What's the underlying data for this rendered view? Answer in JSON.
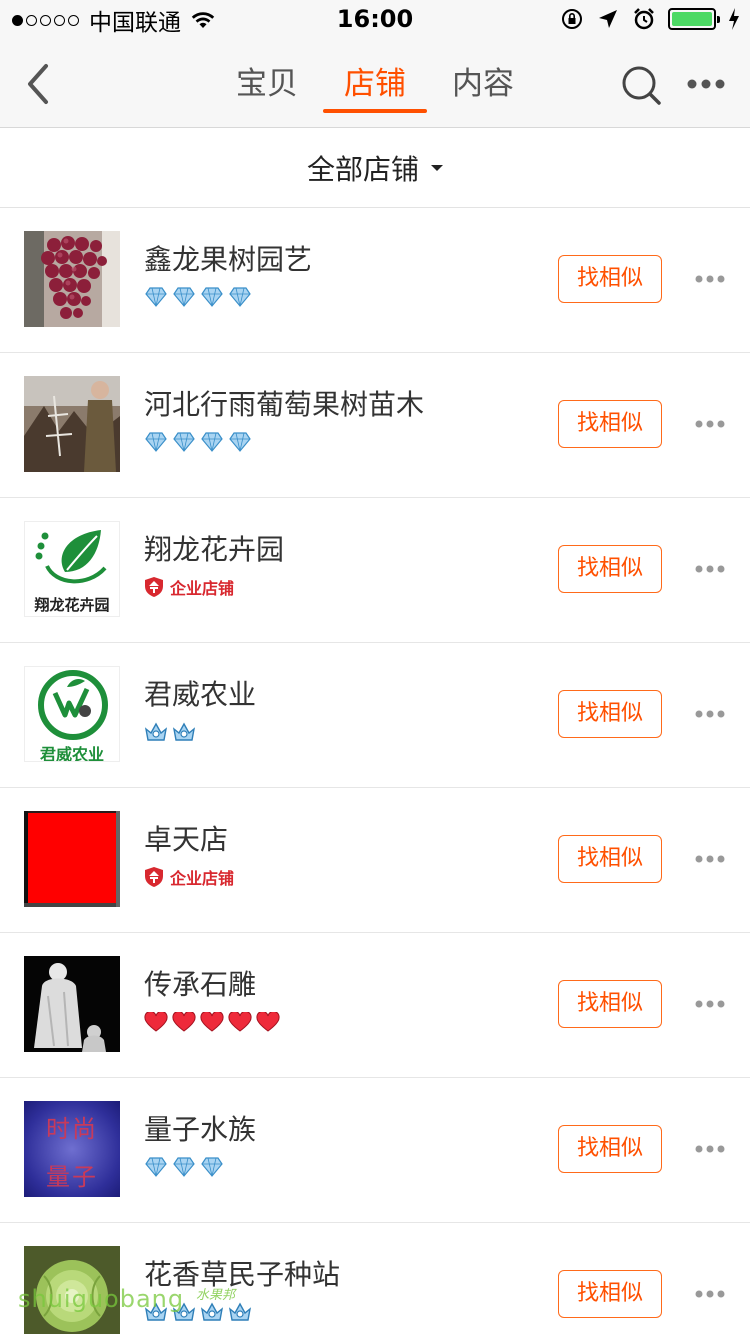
{
  "status_bar": {
    "carrier": "中国联通",
    "time": "16:00",
    "battery_color": "#4cd964"
  },
  "nav": {
    "tabs": [
      {
        "label": "宝贝",
        "active": false
      },
      {
        "label": "店铺",
        "active": true
      },
      {
        "label": "内容",
        "active": false
      }
    ],
    "accent_color": "#ff5000",
    "icons": [
      "back-chevron-icon",
      "search-icon",
      "more-icon"
    ]
  },
  "filter": {
    "label": "全部店铺"
  },
  "shops": [
    {
      "name": "鑫龙果树园艺",
      "rating": {
        "type": "diamond",
        "count": 4
      },
      "action": "找相似"
    },
    {
      "name": "河北行雨葡萄果树苗木",
      "rating": {
        "type": "diamond",
        "count": 4
      },
      "action": "找相似"
    },
    {
      "name": "翔龙花卉园",
      "enterprise_label": "企业店铺",
      "thumb_text": "翔龙花卉园",
      "action": "找相似"
    },
    {
      "name": "君威农业",
      "rating": {
        "type": "crown",
        "count": 2
      },
      "thumb_text": "君威农业",
      "action": "找相似"
    },
    {
      "name": "卓天店",
      "enterprise_label": "企业店铺",
      "action": "找相似"
    },
    {
      "name": "传承石雕",
      "rating": {
        "type": "heart",
        "count": 5
      },
      "action": "找相似"
    },
    {
      "name": "量子水族",
      "rating": {
        "type": "diamond",
        "count": 3
      },
      "thumb_text_top": "时尚",
      "thumb_text_bottom": "量子",
      "action": "找相似"
    },
    {
      "name": "花香草民子种站",
      "rating": {
        "type": "crown",
        "count": 4
      },
      "action": "找相似"
    }
  ],
  "watermark": {
    "text": "shuiguobang",
    "text_cn": "水果邦"
  }
}
